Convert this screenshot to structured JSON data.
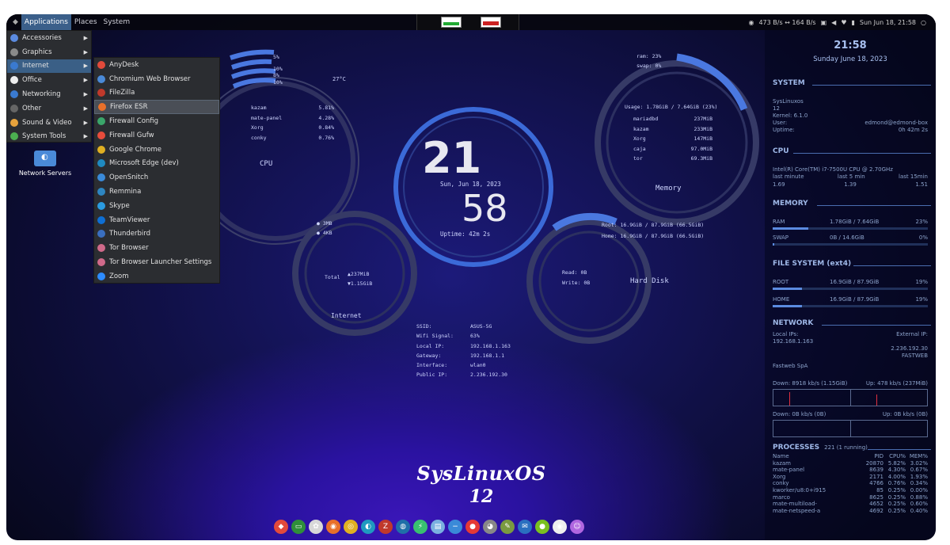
{
  "topbar": {
    "applications": "Applications",
    "places": "Places",
    "system": "System",
    "net_speed": "473 B/s ↔ 164 B/s",
    "datetime": "Sun Jun 18, 21:58"
  },
  "menu_main": [
    {
      "label": "Accessories",
      "color": "#5b8be0"
    },
    {
      "label": "Graphics",
      "color": "#8a8a8a"
    },
    {
      "label": "Internet",
      "color": "#3a7ad0"
    },
    {
      "label": "Office",
      "color": "#eeeeee"
    },
    {
      "label": "Networking",
      "color": "#3a7ad0"
    },
    {
      "label": "Other",
      "color": "#666666"
    },
    {
      "label": "Sound & Video",
      "color": "#e6a23c"
    },
    {
      "label": "System Tools",
      "color": "#4caf50"
    }
  ],
  "menu_internet": [
    {
      "label": "AnyDesk",
      "color": "#e24a3b"
    },
    {
      "label": "Chromium Web Browser",
      "color": "#4a8ad8"
    },
    {
      "label": "FileZilla",
      "color": "#c0392b"
    },
    {
      "label": "Firefox ESR",
      "color": "#e8702a"
    },
    {
      "label": "Firewall Config",
      "color": "#3aa56a"
    },
    {
      "label": "Firewall Gufw",
      "color": "#e74c3c"
    },
    {
      "label": "Google Chrome",
      "color": "#e0b022"
    },
    {
      "label": "Microsoft Edge (dev)",
      "color": "#1f8ac0"
    },
    {
      "label": "OpenSnitch",
      "color": "#3a8ad8"
    },
    {
      "label": "Remmina",
      "color": "#2e86c1"
    },
    {
      "label": "Skype",
      "color": "#2b9be0"
    },
    {
      "label": "TeamViewer",
      "color": "#0e6fd4"
    },
    {
      "label": "Thunderbird",
      "color": "#3a6fc0"
    },
    {
      "label": "Tor Browser",
      "color": "#d06a8a"
    },
    {
      "label": "Tor Browser Launcher Settings",
      "color": "#d06a8a"
    },
    {
      "label": "Zoom",
      "color": "#2d8cff"
    }
  ],
  "desktop_icon": "Network Servers",
  "clock": {
    "hour": "21",
    "minute": "58",
    "date": "Sun, Jun 18, 2023",
    "uptime": "Uptime: 42m 2s"
  },
  "cpu": {
    "title": "CPU",
    "temp": "27°C",
    "cores": [
      "5%",
      "10%",
      "8%",
      "10%"
    ],
    "procs": [
      [
        "kazam",
        "5.81%"
      ],
      [
        "mate-panel",
        "4.28%"
      ],
      [
        "Xorg",
        "0.84%"
      ],
      [
        "conky",
        "0.76%"
      ]
    ]
  },
  "memory": {
    "title": "Memory",
    "ram": "ram: 23%",
    "swap": "swap: 0%",
    "usage": "Usage: 1.78GiB / 7.64GiB (23%)",
    "procs": [
      [
        "mariadbd",
        "237MiB"
      ],
      [
        "kazam",
        "233MiB"
      ],
      [
        "Xorg",
        "147MiB"
      ],
      [
        "caja",
        "97.0MiB"
      ],
      [
        "tor",
        "69.3MiB"
      ]
    ]
  },
  "internet": {
    "title": "Internet",
    "up": "3MB",
    "down": "4KB",
    "total_label": "Total",
    "total_up": "▲237MiB",
    "total_down": "▼1.15GiB"
  },
  "disk": {
    "title": "Hard Disk",
    "root": "Root: 16.9GiB / 87.9GiB (66.5GiB)",
    "home": "Home: 16.9GiB / 87.9GiB (66.5GiB)",
    "read": "Read:  0B",
    "write": "Write: 0B"
  },
  "network_info": [
    [
      "SSID:",
      "ASUS-5G"
    ],
    [
      "Wifi Signal:",
      "63%"
    ],
    [
      "Local IP:",
      "192.168.1.163"
    ],
    [
      "Gateway:",
      "192.168.1.1"
    ],
    [
      "Interface:",
      "wlan0"
    ],
    [
      "Public IP:",
      "2.236.192.30"
    ]
  ],
  "logo": {
    "title": "SysLinuxOS",
    "version": "12"
  },
  "sidebar": {
    "time": "21:58",
    "date": "Sunday June 18, 2023",
    "system_title": "SYSTEM",
    "system": [
      "SysLinuxos",
      "12",
      "Kernel: 6.1.0"
    ],
    "user_label": "User:",
    "user": "edmond@edmond-box",
    "uptime_label": "Uptime:",
    "uptime": "0h 42m 2s",
    "cpu_title": "CPU",
    "cpu_model": "Intel(R) Core(TM) i7-7500U CPU @ 2.70GHz",
    "load_labels": [
      "last minute",
      "last 5 min",
      "last 15min"
    ],
    "load_values": [
      "1.69",
      "1.39",
      "1.51"
    ],
    "memory_title": "MEMORY",
    "ram_label": "RAM",
    "ram": "1.78GiB / 7.64GiB",
    "ram_pct": "23%",
    "ram_fill": 0.23,
    "swap_label": "SWAP",
    "swap": "0B / 14.6GiB",
    "swap_pct": "0%",
    "swap_fill": 0,
    "fs_title": "FILE SYSTEM (ext4)",
    "root_label": "ROOT",
    "root": "16.9GiB / 87.9GiB",
    "root_pct": "19%",
    "root_fill": 0.19,
    "home_label": "HOME",
    "home": "16.9GiB / 87.9GiB",
    "home_pct": "19%",
    "home_fill": 0.19,
    "net_title": "NETWORK",
    "local_ips": "Local IPs:",
    "external_ip": "External IP:",
    "local_ip": "192.168.1.163",
    "ext_ip": "2.236.192.30",
    "isp_right": "FASTWEB",
    "isp": "Fastweb SpA",
    "down": "Down: 8918 kb/s (1.15GiB)",
    "up": "Up: 478 kb/s (237MiB)",
    "down2": "Down: 0B kb/s (0B)",
    "up2": "Up: 0B kb/s (0B)",
    "proc_title": "PROCESSES",
    "proc_count": "221 (1 running)",
    "proc_headers": [
      "Name",
      "PID",
      "CPU%",
      "MEM%"
    ],
    "procs": [
      [
        "kazam",
        "20870",
        "5.82%",
        "3.02%"
      ],
      [
        "mate-panel",
        "8639",
        "4.30%",
        "0.67%"
      ],
      [
        "Xorg",
        "2171",
        "4.00%",
        "1.93%"
      ],
      [
        "conky",
        "4766",
        "0.76%",
        "0.34%"
      ],
      [
        "kworker/u8:0+i915",
        "85",
        "0.25%",
        "0.00%"
      ],
      [
        "marco",
        "8625",
        "0.25%",
        "0.88%"
      ],
      [
        "mate-multiload-",
        "4652",
        "0.25%",
        "0.60%"
      ],
      [
        "mate-netspeed-a",
        "4692",
        "0.25%",
        "0.40%"
      ]
    ]
  },
  "dock": [
    {
      "icon": "anydesk-icon",
      "color": "#e24a3b",
      "glyph": "◆"
    },
    {
      "icon": "terminal-icon",
      "color": "#2f8f3a",
      "glyph": "▭"
    },
    {
      "icon": "settings-icon",
      "color": "#d8d8d8",
      "glyph": "✿"
    },
    {
      "icon": "firefox-icon",
      "color": "#e8702a",
      "glyph": "◉"
    },
    {
      "icon": "chrome-icon",
      "color": "#e0b022",
      "glyph": "◎"
    },
    {
      "icon": "edge-icon",
      "color": "#1f9ac0",
      "glyph": "◐"
    },
    {
      "icon": "filezilla-icon",
      "color": "#c0392b",
      "glyph": "Z"
    },
    {
      "icon": "network-icon",
      "color": "#1f6fa8",
      "glyph": "◍"
    },
    {
      "icon": "lightning-icon",
      "color": "#39c070",
      "glyph": "⚡"
    },
    {
      "icon": "files-icon",
      "color": "#7ab0e0",
      "glyph": "▤"
    },
    {
      "icon": "opensnitch-icon",
      "color": "#3a8ad8",
      "glyph": "−"
    },
    {
      "icon": "firewall-icon",
      "color": "#e53935",
      "glyph": "●"
    },
    {
      "icon": "gimp-icon",
      "color": "#888888",
      "glyph": "◕"
    },
    {
      "icon": "paint-icon",
      "color": "#7a9a40",
      "glyph": "✎"
    },
    {
      "icon": "thunderbird-icon",
      "color": "#2a6fc0",
      "glyph": "✉"
    },
    {
      "icon": "status-icon",
      "color": "#7ac020",
      "glyph": "●"
    },
    {
      "icon": "record-icon",
      "color": "#eeeeee",
      "glyph": "◉"
    },
    {
      "icon": "app-icon",
      "color": "#b066e0",
      "glyph": "☺"
    }
  ]
}
